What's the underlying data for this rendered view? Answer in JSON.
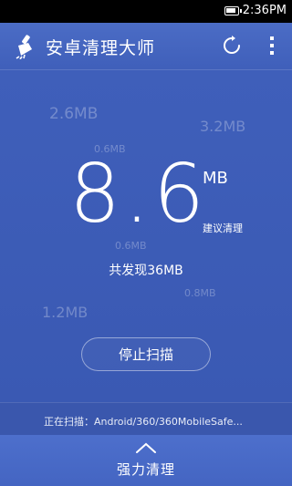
{
  "status_bar": {
    "time": "2:36PM",
    "battery_icon": "battery-icon"
  },
  "app_bar": {
    "title": "安卓清理大师",
    "logo_icon": "broom-icon",
    "refresh_icon": "refresh-icon",
    "more_icon": "more-vert-icon"
  },
  "scan": {
    "floating_sizes": [
      {
        "text": "2.6MB"
      },
      {
        "text": "3.2MB"
      },
      {
        "text": "0.6MB"
      },
      {
        "text": "0.6MB"
      },
      {
        "text": "0.8MB"
      },
      {
        "text": "1.2MB"
      }
    ],
    "total_value": "8.6",
    "total_unit": "MB",
    "suggest_label": "建议清理",
    "found_text": "共发现36MB",
    "stop_button": "停止扫描"
  },
  "scanning": {
    "label": "正在扫描：Android/360/360MobileSafe..."
  },
  "bottom": {
    "chevron_icon": "chevron-up-icon",
    "label": "强力清理"
  },
  "colors": {
    "background": "#3d5db9",
    "status_bar": "#000000",
    "text": "#ffffff"
  }
}
